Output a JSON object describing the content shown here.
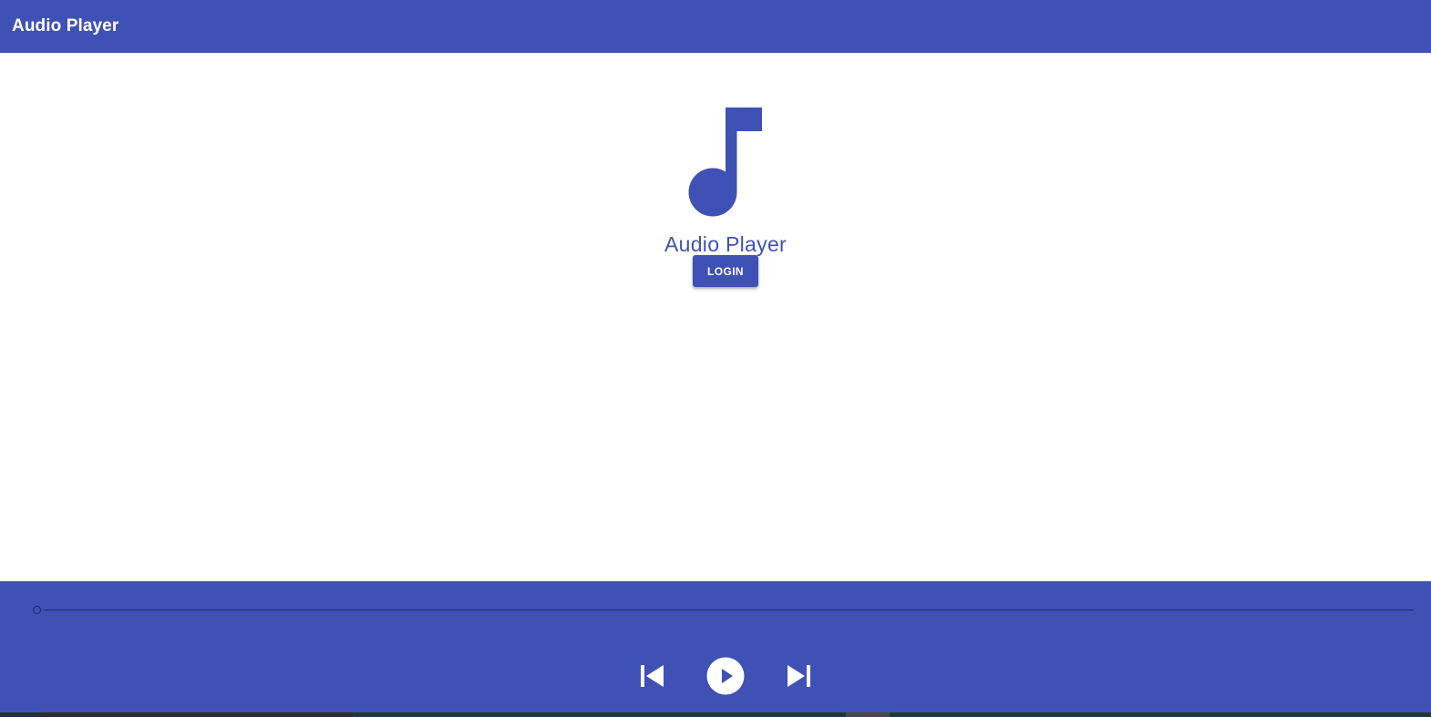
{
  "toolbar": {
    "title": "Audio Player"
  },
  "main": {
    "logo_icon": "music-note-icon",
    "app_name": "Audio Player",
    "login_label": "LOGIN"
  },
  "player": {
    "progress": 0,
    "controls": {
      "previous_icon": "skip-previous-icon",
      "play_icon": "play-icon",
      "next_icon": "skip-next-icon"
    }
  },
  "colors": {
    "primary": "#3f51b5",
    "on_primary": "#ffffff",
    "slider": "#1f2a6b"
  }
}
